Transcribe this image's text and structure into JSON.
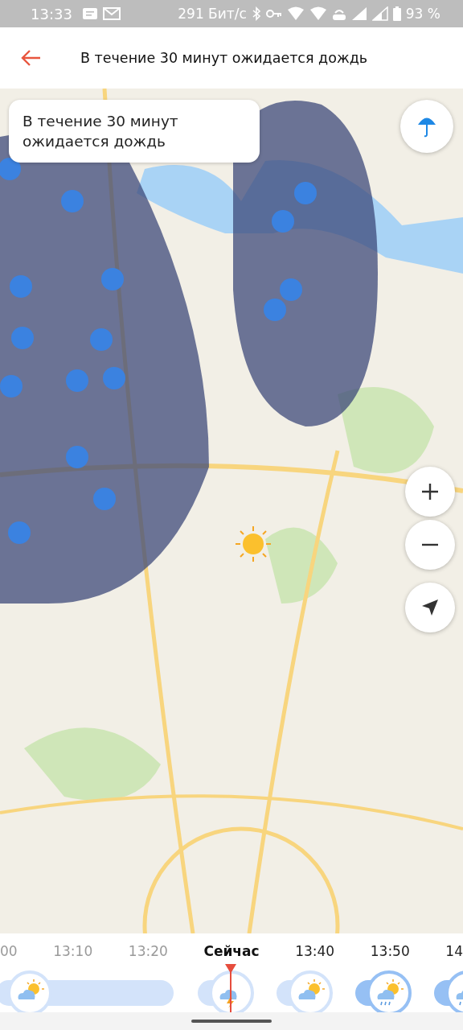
{
  "status_bar": {
    "time": "13:33",
    "speed": "291 Бит/с",
    "battery": "93 %"
  },
  "header": {
    "title": "В течение 30 минут ожидается дождь"
  },
  "map": {
    "callout": "В течение 30 минут ожидается дождь"
  },
  "timeline": {
    "labels": [
      {
        "text": "00",
        "past": true,
        "selected": false
      },
      {
        "text": "13:10",
        "past": true,
        "selected": false
      },
      {
        "text": "13:20",
        "past": true,
        "selected": false
      },
      {
        "text": "Сейчас",
        "past": false,
        "selected": true
      },
      {
        "text": "13:40",
        "past": false,
        "selected": false
      },
      {
        "text": "13:50",
        "past": false,
        "selected": false
      },
      {
        "text": "14",
        "past": false,
        "selected": false
      }
    ],
    "segments": [
      {
        "kind": "partly-cloudy",
        "heavy": false
      },
      {
        "kind": "thunder",
        "heavy": false
      },
      {
        "kind": "partly-cloudy",
        "heavy": false
      },
      {
        "kind": "rain-sun",
        "heavy": true
      },
      {
        "kind": "rain",
        "heavy": true
      }
    ]
  }
}
